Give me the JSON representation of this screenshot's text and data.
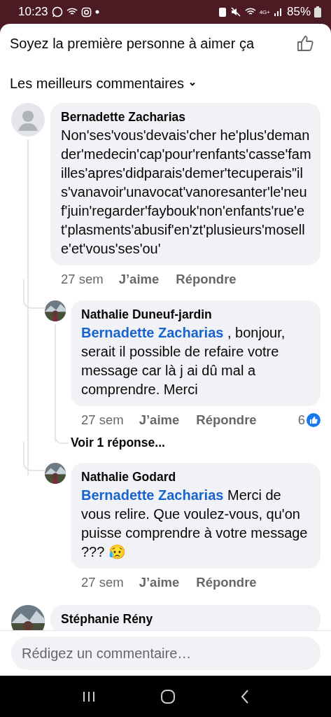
{
  "status_bar": {
    "time": "10:23",
    "network": "4G+",
    "battery": "85%"
  },
  "header": {
    "title": "Soyez la première personne à aimer ça"
  },
  "sort": {
    "label": "Les meilleurs commentaires"
  },
  "comments": [
    {
      "author": "Bernadette Zacharias",
      "avatar": {
        "kind": "silhouette"
      },
      "text": "Non'ses'vous'devais'cher he'plus'demander'medecin'cap'pour'renfants'casse'familles'apres'didparais'demer'tecuperais\"ils'vanavoir'unavocat'vanoresanter'le'neuf'juin'regarder'faybouk'non'enfants'rue'et'plasments'abusif'en'zt'plusieurs'moselle'et'vous'ses'ou'",
      "time": "27 sem",
      "like": "J’aime",
      "reply": "Répondre",
      "replies": [
        {
          "author": "Nathalie Duneuf-jardin",
          "mention": "Bernadette Zacharias",
          "text": ", bonjour, serait il possible de refaire votre message car là j ai dû mal a comprendre. Merci",
          "time": "27 sem",
          "like": "J’aime",
          "reply": "Répondre",
          "reactions": "6",
          "view_replies": "Voir 1 réponse..."
        },
        {
          "author": "Nathalie Godard",
          "mention": "Bernadette Zacharias",
          "text": "Merci de vous relire. Que voulez-vous, qu'on puisse comprendre à votre message ??? 😥",
          "time": "27 sem",
          "like": "J’aime",
          "reply": "Répondre"
        }
      ]
    },
    {
      "author": "Stéphanie Rény"
    }
  ],
  "composer": {
    "placeholder": "Rédigez un commentaire…"
  }
}
